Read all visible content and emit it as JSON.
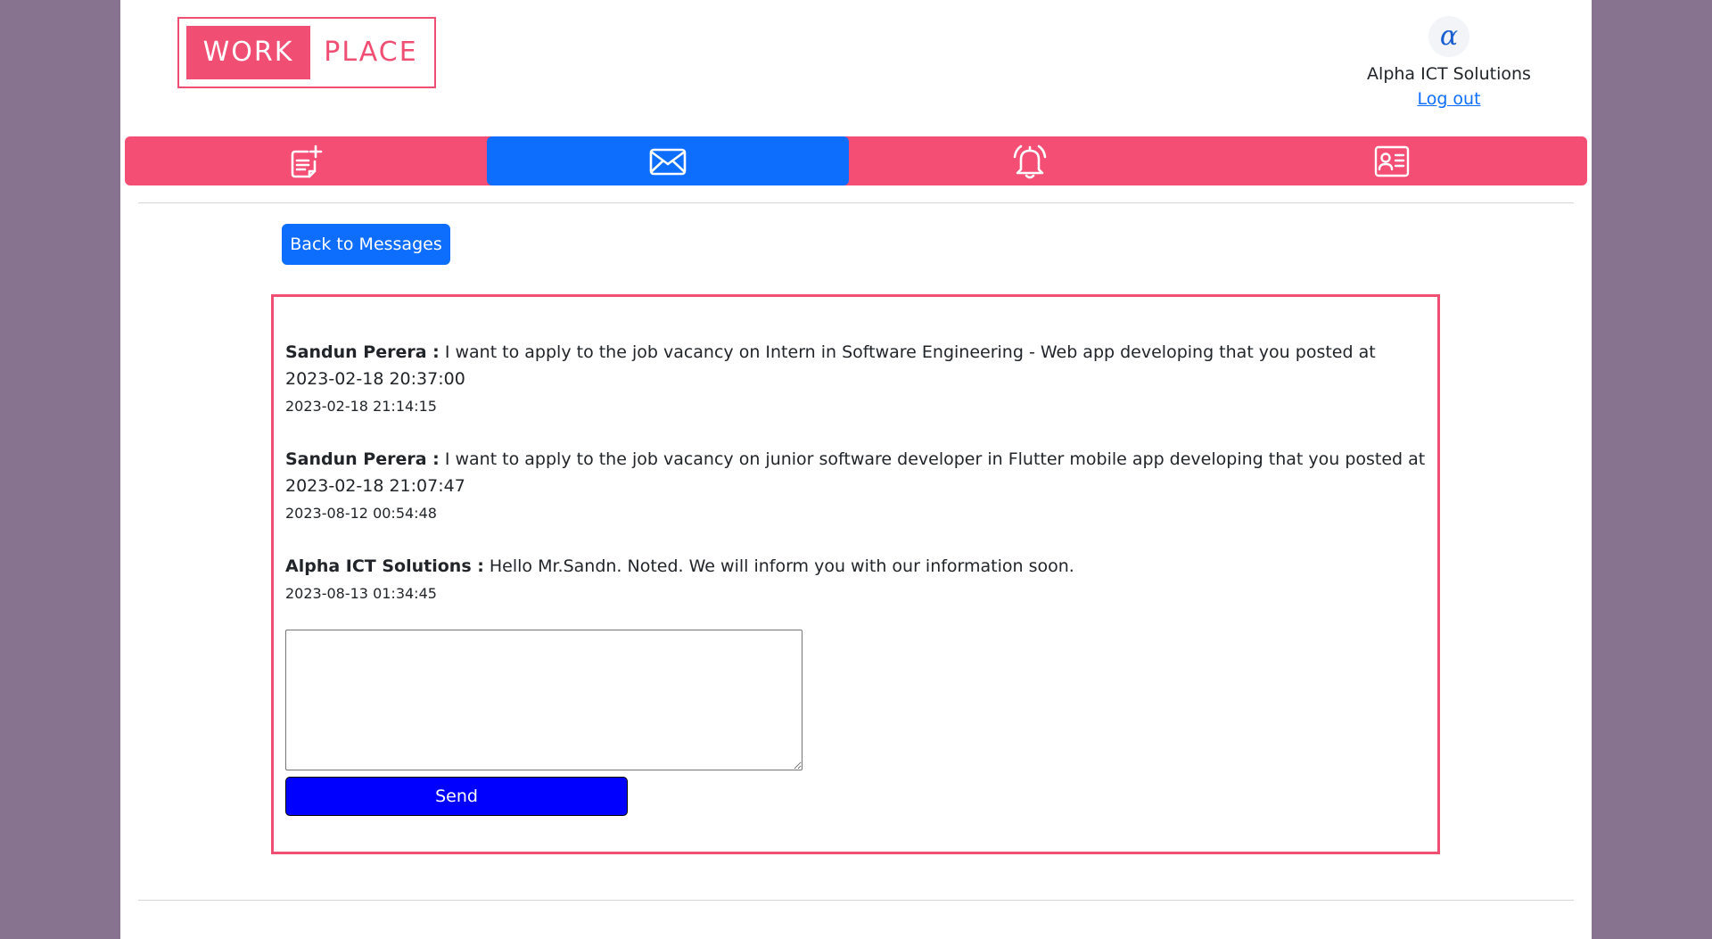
{
  "logo": {
    "left_text": "WORK",
    "right_text": "PLACE"
  },
  "header": {
    "company_name": "Alpha ICT Solutions",
    "logout_label": "Log out",
    "avatar_glyph": "α"
  },
  "nav": {
    "items": [
      {
        "icon": "post-add-icon",
        "active": false
      },
      {
        "icon": "envelope-icon",
        "active": true
      },
      {
        "icon": "bell-icon",
        "active": false
      },
      {
        "icon": "profile-card-icon",
        "active": false
      }
    ]
  },
  "back_button": {
    "label": "Back to Messages"
  },
  "messages": [
    {
      "sender": "Sandun Perera :",
      "text": " I want to apply to the job vacancy on Intern in Software Engineering - Web app developing that you posted at 2023-02-18 20:37:00",
      "timestamp": "2023-02-18 21:14:15"
    },
    {
      "sender": "Sandun Perera :",
      "text": " I want to apply to the job vacancy on junior software developer in Flutter mobile app developing that you posted at 2023-02-18 21:07:47",
      "timestamp": "2023-08-12 00:54:48"
    },
    {
      "sender": "Alpha ICT Solutions :",
      "text": " Hello Mr.Sandn. Noted. We will inform you with our information soon.",
      "timestamp": "2023-08-13 01:34:45"
    }
  ],
  "reply": {
    "value": "",
    "send_label": "Send"
  },
  "colors": {
    "brand_pink": "#f54e75",
    "active_blue": "#0d6efd",
    "send_blue": "#0000ff",
    "backdrop": "#87738f"
  }
}
